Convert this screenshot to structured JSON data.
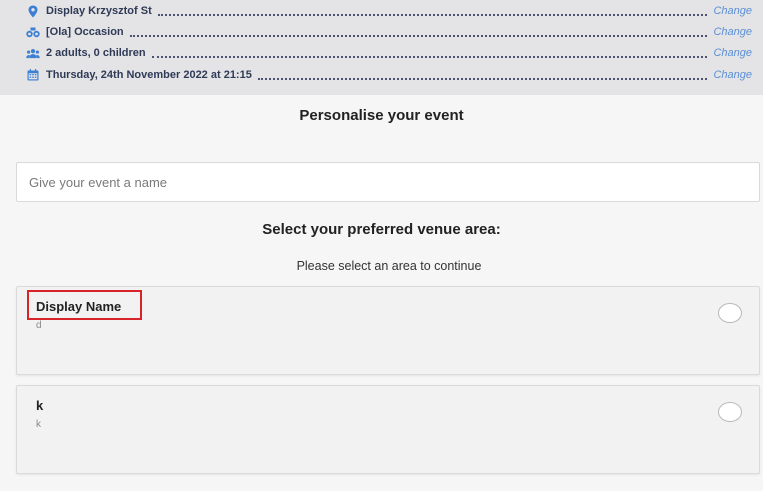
{
  "summary": {
    "change_label": "Change",
    "rows": [
      {
        "icon": "map-pin-icon",
        "text": "Display Krzysztof St"
      },
      {
        "icon": "binoculars-icon",
        "text": "[Ola] Occasion"
      },
      {
        "icon": "people-icon",
        "text": "2 adults, 0 children"
      },
      {
        "icon": "calendar-icon",
        "text": "Thursday, 24th November 2022 at 21:15"
      }
    ],
    "icon_color": "#3d7fd3",
    "link_color": "#5b8fd6"
  },
  "personalise": {
    "title": "Personalise your event",
    "event_name_placeholder": "Give your event a name",
    "event_name_value": ""
  },
  "venue": {
    "title": "Select your preferred venue area:",
    "note": "Please select an area to continue",
    "areas": [
      {
        "name": "Display Name",
        "description": "d",
        "selected": false
      },
      {
        "name": "k",
        "description": "k",
        "selected": false
      }
    ]
  },
  "colors": {
    "highlight": "#d8232a"
  }
}
